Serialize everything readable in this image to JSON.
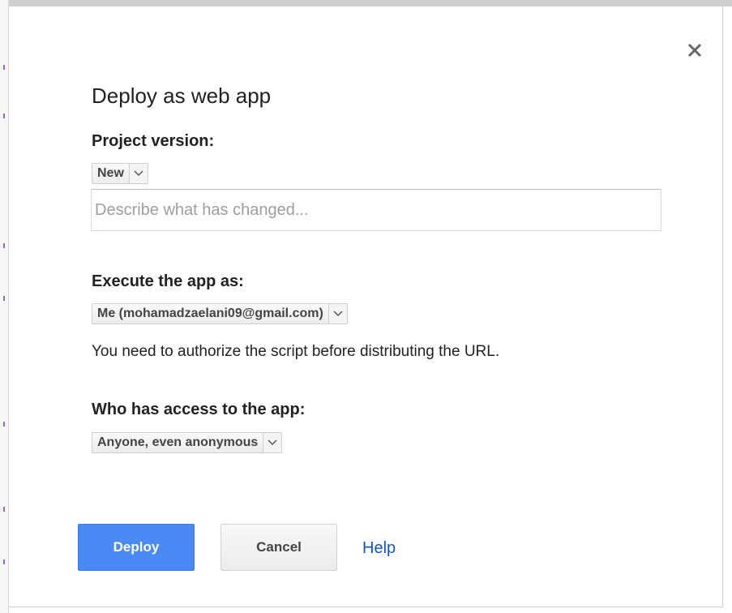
{
  "dialog": {
    "title": "Deploy as web app",
    "close_icon": "close-icon"
  },
  "project_version": {
    "label": "Project version:",
    "selected": "New",
    "description_placeholder": "Describe what has changed...",
    "description_value": ""
  },
  "execute_as": {
    "label": "Execute the app as:",
    "selected": "Me (mohamadzaelani09@gmail.com)",
    "note": "You need to authorize the script before distributing the URL."
  },
  "access": {
    "label": "Who has access to the app:",
    "selected": "Anyone, even anonymous"
  },
  "buttons": {
    "deploy": "Deploy",
    "cancel": "Cancel",
    "help": "Help"
  },
  "colors": {
    "primary": "#4a8af4",
    "link": "#1155cc"
  }
}
